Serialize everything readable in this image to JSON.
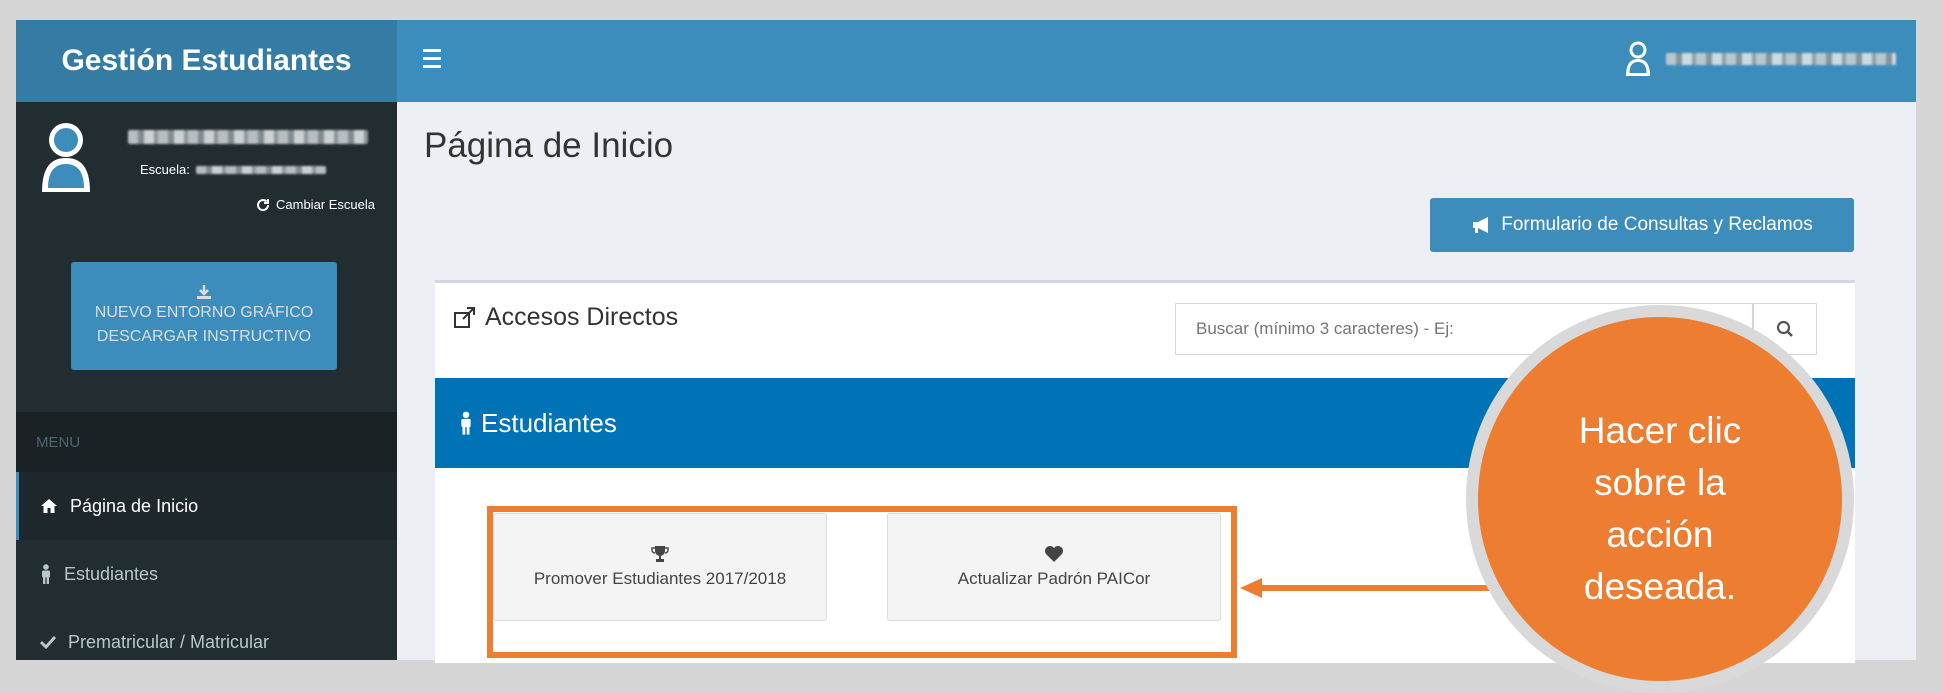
{
  "sidebar": {
    "app_title": "Gestión Estudiantes",
    "school_label": "Escuela:",
    "change_school": "Cambiar Escuela",
    "download_button": {
      "line1": "NUEVO ENTORNO GRÁFICO",
      "line2": "DESCARGAR INSTRUCTIVO"
    },
    "menu_header": "MENU",
    "items": [
      {
        "label": "Página de Inicio",
        "icon": "home-icon"
      },
      {
        "label": "Estudiantes",
        "icon": "male-icon"
      },
      {
        "label": "Prematricular / Matricular",
        "icon": "check-icon"
      }
    ]
  },
  "main": {
    "title": "Página de Inicio",
    "form_button": "Formulario de Consultas y Reclamos",
    "box_title": "Accesos Directos",
    "search_placeholder": "Buscar (mínimo 3 caracteres) - Ej: ",
    "section_title": "Estudiantes",
    "actions": [
      {
        "label": "Promover Estudiantes 2017/2018",
        "icon": "trophy-icon"
      },
      {
        "label": "Actualizar Padrón PAICor",
        "icon": "heart-icon"
      }
    ]
  },
  "callout": {
    "text": "Hacer clic sobre la acción deseada.",
    "color": "#ed7d31"
  },
  "colors": {
    "sidebar_bg": "#222d32",
    "header_bg": "#3c8dbc",
    "section_bg": "#0073b7",
    "highlight": "#ed7d31"
  }
}
